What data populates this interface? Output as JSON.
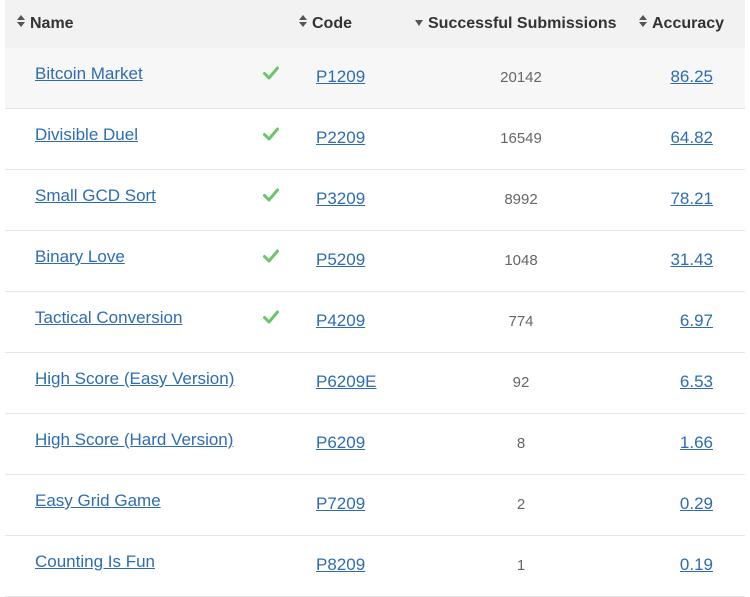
{
  "columns": {
    "name": "Name",
    "code": "Code",
    "subs": "Successful Submissions",
    "acc": "Accuracy"
  },
  "icons": {
    "sort": "sort-both-icon",
    "sort_desc": "sort-desc-icon",
    "solved": "check-icon"
  },
  "colors": {
    "link": "#2d6cb3",
    "check": "#6cc46c",
    "header_bg": "#f2f2f2"
  },
  "rows": [
    {
      "name": "Bitcoin Market",
      "code": "P1209",
      "subs": "20142",
      "acc": "86.25",
      "solved": true
    },
    {
      "name": "Divisible Duel",
      "code": "P2209",
      "subs": "16549",
      "acc": "64.82",
      "solved": true
    },
    {
      "name": "Small GCD Sort",
      "code": "P3209",
      "subs": "8992",
      "acc": "78.21",
      "solved": true
    },
    {
      "name": "Binary Love",
      "code": "P5209",
      "subs": "1048",
      "acc": "31.43",
      "solved": true
    },
    {
      "name": "Tactical Conversion",
      "code": "P4209",
      "subs": "774",
      "acc": "6.97",
      "solved": true
    },
    {
      "name": "High Score (Easy Version)",
      "code": "P6209E",
      "subs": "92",
      "acc": "6.53",
      "solved": false
    },
    {
      "name": "High Score (Hard Version)",
      "code": "P6209",
      "subs": "8",
      "acc": "1.66",
      "solved": false
    },
    {
      "name": "Easy Grid Game",
      "code": "P7209",
      "subs": "2",
      "acc": "0.29",
      "solved": false
    },
    {
      "name": "Counting Is Fun",
      "code": "P8209",
      "subs": "1",
      "acc": "0.19",
      "solved": false
    }
  ]
}
